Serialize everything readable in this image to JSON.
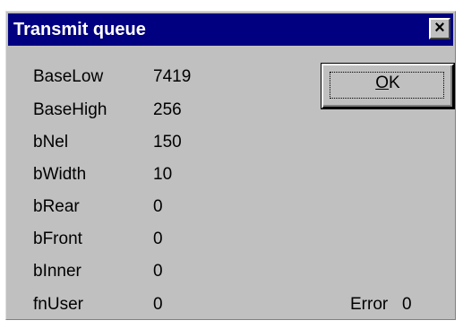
{
  "window": {
    "title": "Transmit queue",
    "close_glyph": "×"
  },
  "fields": [
    {
      "label": "BaseLow",
      "value": "7419"
    },
    {
      "label": "BaseHigh",
      "value": "256"
    },
    {
      "label": "bNel",
      "value": "150"
    },
    {
      "label": "bWidth",
      "value": "10"
    },
    {
      "label": "bRear",
      "value": "0"
    },
    {
      "label": "bFront",
      "value": "0"
    },
    {
      "label": "bInner",
      "value": "0"
    },
    {
      "label": "fnUser",
      "value": "0"
    }
  ],
  "ok_button": {
    "mnemonic": "O",
    "rest": "K"
  },
  "error": {
    "label": "Error",
    "value": "0"
  },
  "colors": {
    "titlebar": "#000080",
    "dialog_face": "#c0c0c0",
    "title_text": "#ffffff"
  }
}
